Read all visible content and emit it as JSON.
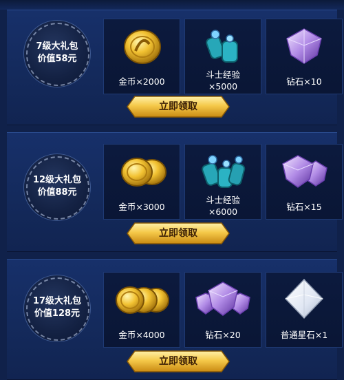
{
  "packs": [
    {
      "badge": {
        "line1": "7级大礼包",
        "line2": "价值58元"
      },
      "items": [
        {
          "icon": "gold-coins-icon",
          "label": "金币×2000",
          "label2": ""
        },
        {
          "icon": "fighter-exp-potion-icon",
          "label": "斗士经验",
          "label2": "×5000"
        },
        {
          "icon": "diamond-icon",
          "label": "钻石×10",
          "label2": ""
        }
      ],
      "button": "立即领取"
    },
    {
      "badge": {
        "line1": "12级大礼包",
        "line2": "价值88元"
      },
      "items": [
        {
          "icon": "gold-coins-icon",
          "label": "金币×3000",
          "label2": ""
        },
        {
          "icon": "fighter-exp-potion-icon",
          "label": "斗士经验",
          "label2": "×6000"
        },
        {
          "icon": "diamond-icon",
          "label": "钻石×15",
          "label2": ""
        }
      ],
      "button": "立即领取"
    },
    {
      "badge": {
        "line1": "17级大礼包",
        "line2": "价值128元"
      },
      "items": [
        {
          "icon": "gold-coins-icon",
          "label": "金币×4000",
          "label2": ""
        },
        {
          "icon": "diamond-icon",
          "label": "钻石×20",
          "label2": ""
        },
        {
          "icon": "star-stone-icon",
          "label": "普通星石×1",
          "label2": ""
        }
      ],
      "button": "立即领取"
    }
  ],
  "colors": {
    "background": "#10214a",
    "panel": "#17306a",
    "gold": "#e8b43a",
    "diamond": "#b58de8"
  }
}
